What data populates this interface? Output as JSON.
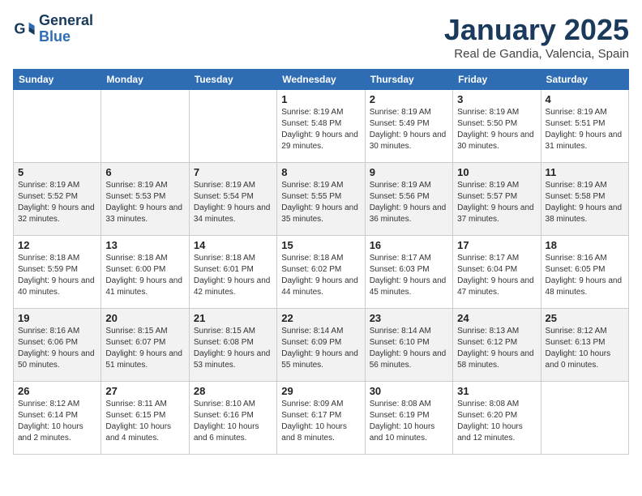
{
  "logo": {
    "line1": "General",
    "line2": "Blue"
  },
  "title": "January 2025",
  "subtitle": "Real de Gandia, Valencia, Spain",
  "days_of_week": [
    "Sunday",
    "Monday",
    "Tuesday",
    "Wednesday",
    "Thursday",
    "Friday",
    "Saturday"
  ],
  "weeks": [
    [
      {
        "day": "",
        "info": ""
      },
      {
        "day": "",
        "info": ""
      },
      {
        "day": "",
        "info": ""
      },
      {
        "day": "1",
        "info": "Sunrise: 8:19 AM\nSunset: 5:48 PM\nDaylight: 9 hours and 29 minutes."
      },
      {
        "day": "2",
        "info": "Sunrise: 8:19 AM\nSunset: 5:49 PM\nDaylight: 9 hours and 30 minutes."
      },
      {
        "day": "3",
        "info": "Sunrise: 8:19 AM\nSunset: 5:50 PM\nDaylight: 9 hours and 30 minutes."
      },
      {
        "day": "4",
        "info": "Sunrise: 8:19 AM\nSunset: 5:51 PM\nDaylight: 9 hours and 31 minutes."
      }
    ],
    [
      {
        "day": "5",
        "info": "Sunrise: 8:19 AM\nSunset: 5:52 PM\nDaylight: 9 hours and 32 minutes."
      },
      {
        "day": "6",
        "info": "Sunrise: 8:19 AM\nSunset: 5:53 PM\nDaylight: 9 hours and 33 minutes."
      },
      {
        "day": "7",
        "info": "Sunrise: 8:19 AM\nSunset: 5:54 PM\nDaylight: 9 hours and 34 minutes."
      },
      {
        "day": "8",
        "info": "Sunrise: 8:19 AM\nSunset: 5:55 PM\nDaylight: 9 hours and 35 minutes."
      },
      {
        "day": "9",
        "info": "Sunrise: 8:19 AM\nSunset: 5:56 PM\nDaylight: 9 hours and 36 minutes."
      },
      {
        "day": "10",
        "info": "Sunrise: 8:19 AM\nSunset: 5:57 PM\nDaylight: 9 hours and 37 minutes."
      },
      {
        "day": "11",
        "info": "Sunrise: 8:19 AM\nSunset: 5:58 PM\nDaylight: 9 hours and 38 minutes."
      }
    ],
    [
      {
        "day": "12",
        "info": "Sunrise: 8:18 AM\nSunset: 5:59 PM\nDaylight: 9 hours and 40 minutes."
      },
      {
        "day": "13",
        "info": "Sunrise: 8:18 AM\nSunset: 6:00 PM\nDaylight: 9 hours and 41 minutes."
      },
      {
        "day": "14",
        "info": "Sunrise: 8:18 AM\nSunset: 6:01 PM\nDaylight: 9 hours and 42 minutes."
      },
      {
        "day": "15",
        "info": "Sunrise: 8:18 AM\nSunset: 6:02 PM\nDaylight: 9 hours and 44 minutes."
      },
      {
        "day": "16",
        "info": "Sunrise: 8:17 AM\nSunset: 6:03 PM\nDaylight: 9 hours and 45 minutes."
      },
      {
        "day": "17",
        "info": "Sunrise: 8:17 AM\nSunset: 6:04 PM\nDaylight: 9 hours and 47 minutes."
      },
      {
        "day": "18",
        "info": "Sunrise: 8:16 AM\nSunset: 6:05 PM\nDaylight: 9 hours and 48 minutes."
      }
    ],
    [
      {
        "day": "19",
        "info": "Sunrise: 8:16 AM\nSunset: 6:06 PM\nDaylight: 9 hours and 50 minutes."
      },
      {
        "day": "20",
        "info": "Sunrise: 8:15 AM\nSunset: 6:07 PM\nDaylight: 9 hours and 51 minutes."
      },
      {
        "day": "21",
        "info": "Sunrise: 8:15 AM\nSunset: 6:08 PM\nDaylight: 9 hours and 53 minutes."
      },
      {
        "day": "22",
        "info": "Sunrise: 8:14 AM\nSunset: 6:09 PM\nDaylight: 9 hours and 55 minutes."
      },
      {
        "day": "23",
        "info": "Sunrise: 8:14 AM\nSunset: 6:10 PM\nDaylight: 9 hours and 56 minutes."
      },
      {
        "day": "24",
        "info": "Sunrise: 8:13 AM\nSunset: 6:12 PM\nDaylight: 9 hours and 58 minutes."
      },
      {
        "day": "25",
        "info": "Sunrise: 8:12 AM\nSunset: 6:13 PM\nDaylight: 10 hours and 0 minutes."
      }
    ],
    [
      {
        "day": "26",
        "info": "Sunrise: 8:12 AM\nSunset: 6:14 PM\nDaylight: 10 hours and 2 minutes."
      },
      {
        "day": "27",
        "info": "Sunrise: 8:11 AM\nSunset: 6:15 PM\nDaylight: 10 hours and 4 minutes."
      },
      {
        "day": "28",
        "info": "Sunrise: 8:10 AM\nSunset: 6:16 PM\nDaylight: 10 hours and 6 minutes."
      },
      {
        "day": "29",
        "info": "Sunrise: 8:09 AM\nSunset: 6:17 PM\nDaylight: 10 hours and 8 minutes."
      },
      {
        "day": "30",
        "info": "Sunrise: 8:08 AM\nSunset: 6:19 PM\nDaylight: 10 hours and 10 minutes."
      },
      {
        "day": "31",
        "info": "Sunrise: 8:08 AM\nSunset: 6:20 PM\nDaylight: 10 hours and 12 minutes."
      },
      {
        "day": "",
        "info": ""
      }
    ]
  ]
}
